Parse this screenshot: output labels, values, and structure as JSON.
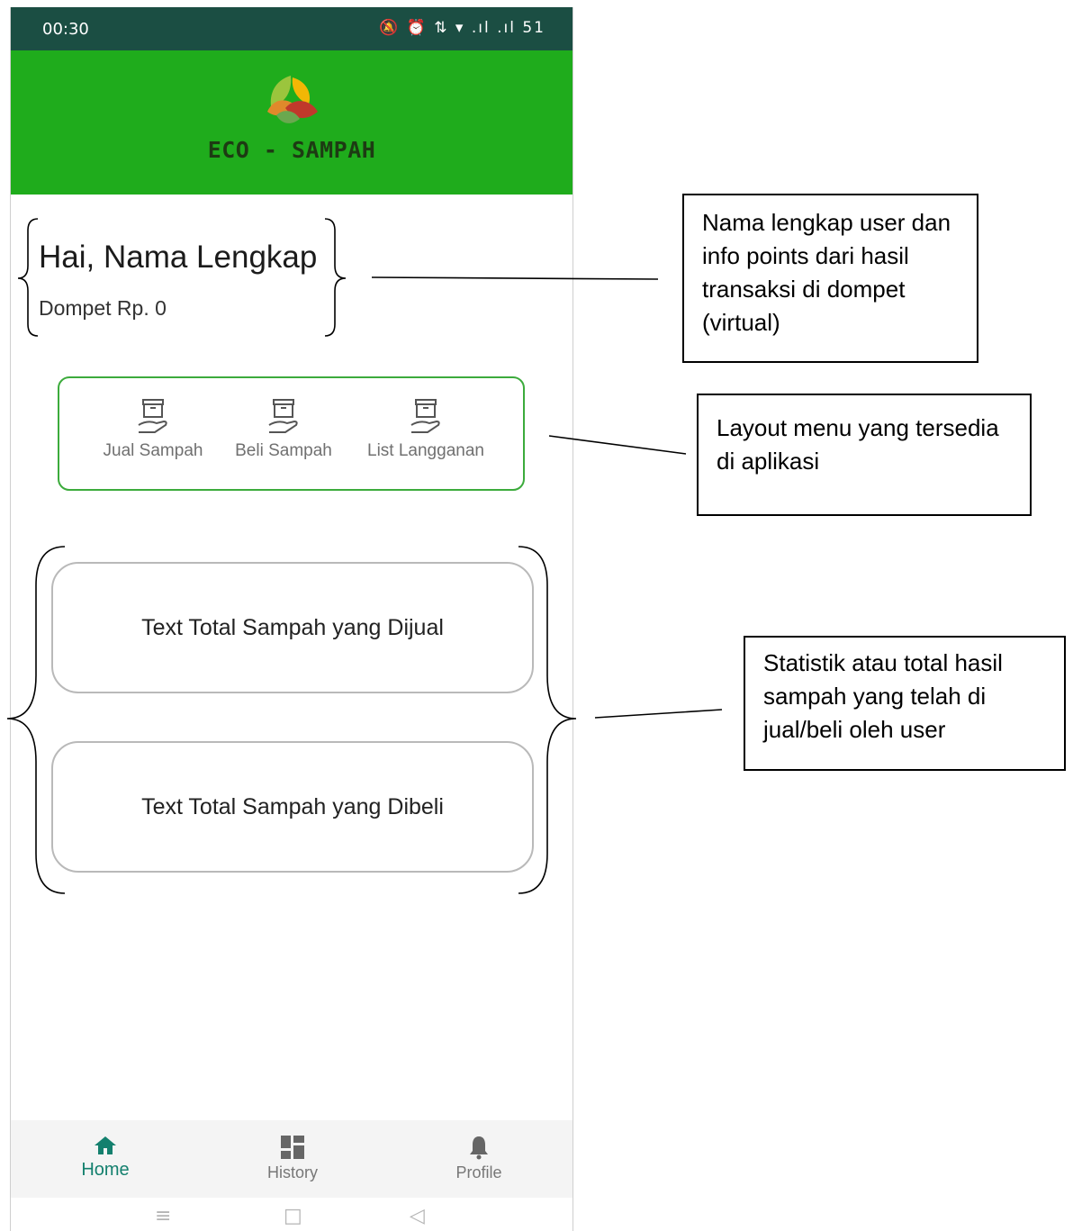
{
  "status_bar": {
    "time": "00:30",
    "icons_text": "🔕 ⏰ ⇅ ▾ .ıl .ıl 51"
  },
  "header": {
    "app_title": "ECO - SAMPAH",
    "logo_icon": "leaves-logo",
    "background_color": "#1fac1c"
  },
  "profile": {
    "greeting": "Hai, Nama Lengkap",
    "wallet": "Dompet Rp. 0"
  },
  "menu": {
    "items": [
      {
        "label": "Jual Sampah",
        "icon": "box-hand-icon"
      },
      {
        "label": "Beli Sampah",
        "icon": "box-hand-icon"
      },
      {
        "label": "List Langganan",
        "icon": "box-hand-icon"
      }
    ],
    "border_color": "#3cab3c"
  },
  "stats": {
    "sold_label": "Text Total Sampah yang Dijual",
    "bought_label": "Text Total Sampah yang Dibeli"
  },
  "bottom_nav": {
    "items": [
      {
        "label": "Home",
        "icon": "home-icon",
        "active": true
      },
      {
        "label": "History",
        "icon": "dashboard-icon",
        "active": false
      },
      {
        "label": "Profile",
        "icon": "bell-icon",
        "active": false
      }
    ],
    "active_color": "#14806e"
  },
  "system_nav": {
    "menu_glyph": "≡",
    "home_glyph": "□",
    "back_glyph": "◁"
  },
  "annotations": {
    "user_note": "Nama lengkap user dan info points dari hasil transaksi di dompet (virtual)",
    "menu_note": "Layout menu yang tersedia di aplikasi",
    "stats_note": "Statistik atau total hasil sampah yang telah di jual/beli oleh user"
  }
}
